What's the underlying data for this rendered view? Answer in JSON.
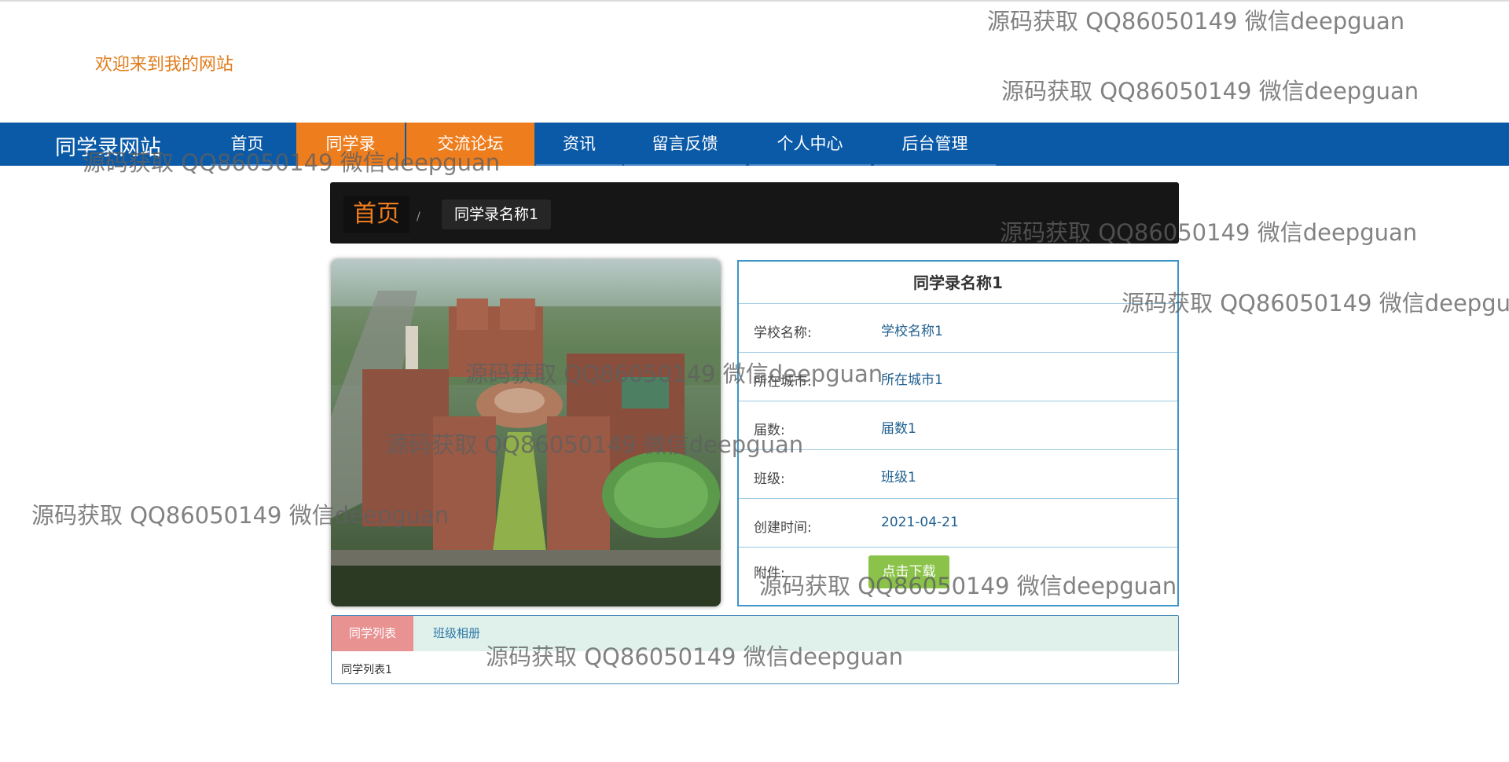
{
  "header": {
    "welcome": "欢迎来到我的网站"
  },
  "nav": {
    "brand": "同学录网站",
    "items": [
      {
        "label": "首页"
      },
      {
        "label": "同学录",
        "active": true
      },
      {
        "label": "交流论坛",
        "active": true
      },
      {
        "label": "资讯"
      },
      {
        "label": "留言反馈"
      },
      {
        "label": "个人中心"
      },
      {
        "label": "后台管理"
      }
    ]
  },
  "breadcrumb": {
    "home": "首页",
    "separator": "/",
    "current": "同学录名称1"
  },
  "detail": {
    "title": "同学录名称1",
    "rows": [
      {
        "label": "学校名称:",
        "value": "学校名称1"
      },
      {
        "label": "所在城市:",
        "value": "所在城市1"
      },
      {
        "label": "届数:",
        "value": "届数1"
      },
      {
        "label": "班级:",
        "value": "班级1"
      },
      {
        "label": "创建时间:",
        "value": "2021-04-21"
      }
    ],
    "attachment_label": "附件:",
    "download_button": "点击下载"
  },
  "tabs": {
    "items": [
      {
        "label": "同学列表",
        "active": true
      },
      {
        "label": "班级相册"
      }
    ],
    "content": "同学列表1"
  },
  "watermark": "源码获取 QQ86050149 微信deepguan",
  "colors": {
    "nav_bg": "#0b5aa8",
    "accent_orange": "#ee7d1e",
    "download_green": "#8bc34a",
    "tab_active": "#e89292"
  }
}
